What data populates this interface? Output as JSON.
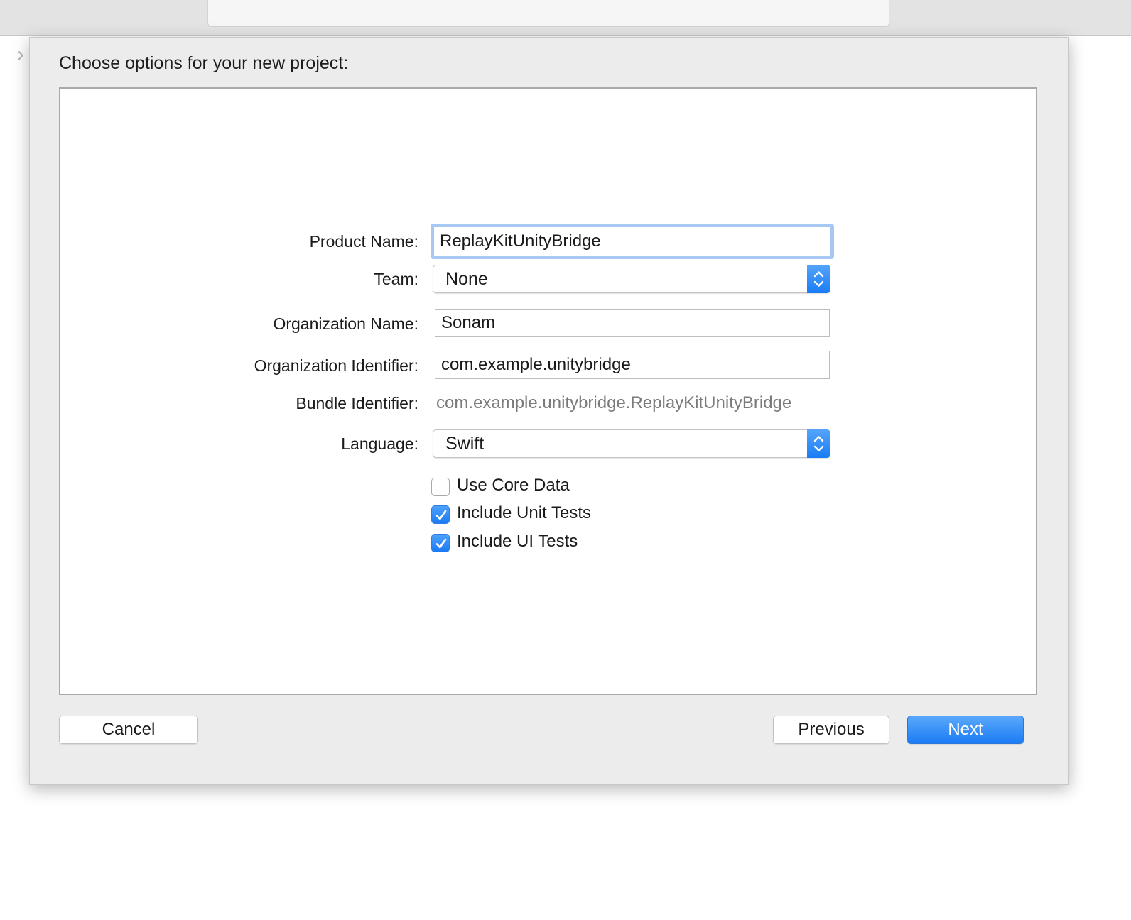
{
  "sheet": {
    "title": "Choose options for your new project:"
  },
  "form": {
    "product_name": {
      "label": "Product Name:",
      "value": "ReplayKitUnityBridge"
    },
    "team": {
      "label": "Team:",
      "value": "None"
    },
    "organization_name": {
      "label": "Organization Name:",
      "value": "Sonam"
    },
    "organization_identifier": {
      "label": "Organization Identifier:",
      "value": "com.example.unitybridge"
    },
    "bundle_identifier": {
      "label": "Bundle Identifier:",
      "value": "com.example.unitybridge.ReplayKitUnityBridge"
    },
    "language": {
      "label": "Language:",
      "value": "Swift"
    },
    "checkboxes": [
      {
        "label": "Use Core Data",
        "checked": false
      },
      {
        "label": "Include Unit Tests",
        "checked": true
      },
      {
        "label": "Include UI Tests",
        "checked": true
      }
    ]
  },
  "buttons": {
    "cancel": "Cancel",
    "previous": "Previous",
    "next": "Next"
  },
  "colors": {
    "accent": "#1b7cf5",
    "focus_ring": "#a6c8f3",
    "secondary_text": "#7b7b7b"
  },
  "icons": {
    "popup": "chevron-up-down-icon",
    "checkbox": "checkmark-icon",
    "back": "chevron-left-icon"
  }
}
